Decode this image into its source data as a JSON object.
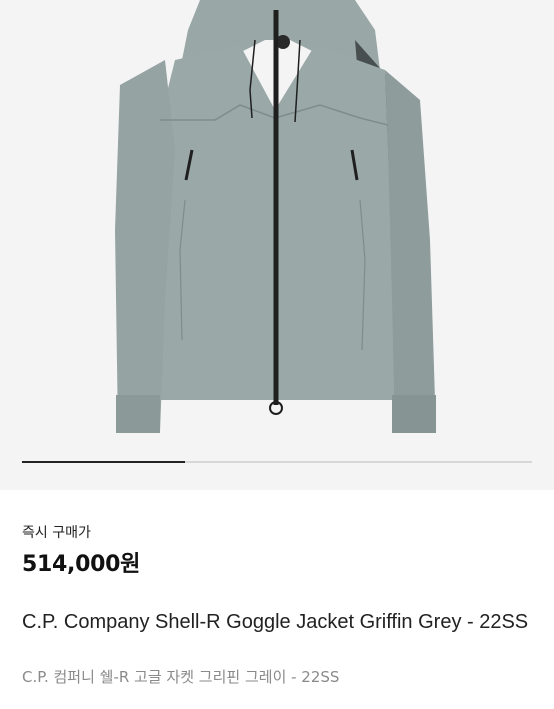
{
  "product": {
    "image_alt": "jacket-photo",
    "carousel_progress": 0.32,
    "price_label": "즉시 구매가",
    "price": "514,000원",
    "title": "C.P. Company Shell-R Goggle Jacket Griffin Grey - 22SS",
    "subtitle": "C.P. 컴퍼니 쉘-R 고글 자켓 그리핀 그레이 - 22SS"
  },
  "colors": {
    "jacket": "#99a6a6",
    "jacket_shadow": "#7f8c8c",
    "zipper": "#1f1f1f",
    "background": "#f4f4f4"
  }
}
